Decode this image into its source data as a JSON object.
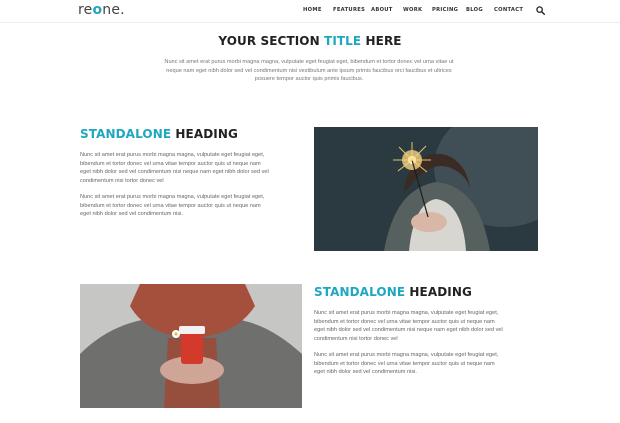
{
  "header": {
    "logo": {
      "prefix": "re",
      "accent": "o",
      "suffix": "ne."
    },
    "nav": [
      "HOME",
      "FEATURES",
      "ABOUT",
      "WORK",
      "PRICING",
      "BLOG",
      "CONTACT"
    ],
    "search_icon": "search-icon"
  },
  "section": {
    "title_prefix": "YOUR SECTION ",
    "title_accent": "TITLE",
    "title_suffix": " HERE",
    "desc_lines": [
      "Nunc sit amet erat purus morbi magna magna, vulputate eget feugiat eget, bibendum et tortor donec vel urna vitae ut",
      "neque nam eget nibh dolor sed vel condimentum nisi vestibulum ante ipsum primis faucibus orci faucibus et ultrices",
      "posuere tempor auctor quis primis faucibus."
    ]
  },
  "blocks": [
    {
      "heading_accent": "STANDALONE",
      "heading_rest": " HEADING",
      "para1_lines": [
        "Nunc sit amet erat purus morbi magna magna, vulputate eget feugiat eget,",
        "bibendum et tortor donec vel urna vitae tempor auctor quis ut neque nam",
        "eget nibh dolor sed vel condimentum nisi neque nam eget nibh dolor sed vel",
        "condimentum nisi tortor donec vel"
      ],
      "para2_lines": [
        "Nunc sit amet erat purus morbi magna magna, vulputate eget feugiat eget,",
        "bibendum et tortor donec vel urna vitae tempor auctor quis ut neque nam",
        "eget nibh dolor sed vel condimentum nisi."
      ]
    },
    {
      "heading_accent": "STANDALONE",
      "heading_rest": " HEADING",
      "para1_lines": [
        "Nunc sit amet erat purus morbi magna magna, vulputate eget feugiat eget,",
        "bibendum et tortor donec vel urna vitae tempor auctor quis ut neque nam",
        "eget nibh dolor sed vel condimentum nisi neque nam eget nibh dolor sed vel",
        "condimentum nisi tortor donec vel"
      ],
      "para2_lines": [
        "Nunc sit amet erat purus morbi magna magna, vulputate eget feugiat eget,",
        "bibendum et tortor donec vel urna vitae tempor auctor quis ut neque nam",
        "eget nibh dolor sed vel condimentum nisi."
      ]
    }
  ],
  "colors": {
    "accent": "#1ea7c0",
    "text_dark": "#222222",
    "text_body": "#666666"
  }
}
